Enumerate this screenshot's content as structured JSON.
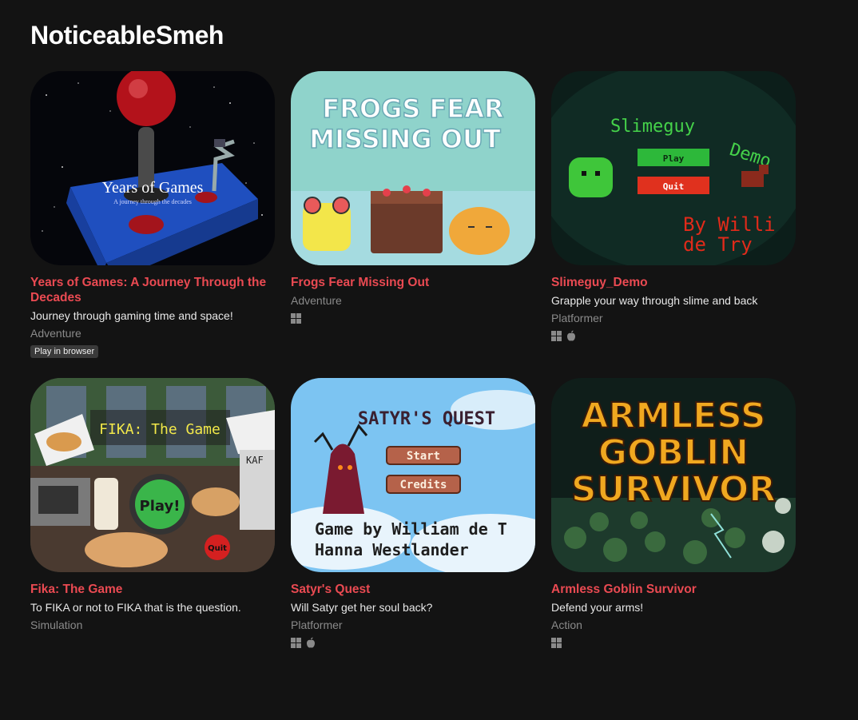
{
  "page": {
    "title": "NoticeableSmeh"
  },
  "games": [
    {
      "title": "Years of Games: A Journey Through the Decades",
      "description": "Journey through gaming time and space!",
      "genre": "Adventure",
      "badge": "Play in browser",
      "thumb_text": [
        "Years of Games",
        "A journey through the decades"
      ]
    },
    {
      "title": "Frogs Fear Missing Out",
      "genre": "Adventure",
      "platforms": [
        "windows-icon"
      ],
      "thumb_text": [
        "FROGS FEAR",
        "MISSING OUT"
      ]
    },
    {
      "title": "Slimeguy_Demo",
      "description": "Grapple your way through slime and back",
      "genre": "Platformer",
      "platforms": [
        "windows-icon",
        "apple-icon"
      ],
      "thumb_text": [
        "Slimeguy",
        "Demo",
        "Play",
        "Quit",
        "By Willi",
        "de Try"
      ]
    },
    {
      "title": "Fika: The Game",
      "description": "To FIKA or not to FIKA that is the question.",
      "genre": "Simulation",
      "thumb_text": [
        "FIKA: The Game",
        "Play!",
        "Quit",
        "KAF"
      ]
    },
    {
      "title": "Satyr's Quest",
      "description": "Will Satyr get her soul back?",
      "genre": "Platformer",
      "platforms": [
        "windows-icon",
        "apple-icon"
      ],
      "thumb_text": [
        "SATYR'S QUEST",
        "Start",
        "Credits",
        "Game by William de T",
        "Hanna Westlander"
      ]
    },
    {
      "title": "Armless Goblin Survivor",
      "description": "Defend your arms!",
      "genre": "Action",
      "platforms": [
        "windows-icon"
      ],
      "thumb_text": [
        "ARMLESS",
        "GOBLIN",
        "SURVIVOR"
      ]
    }
  ]
}
